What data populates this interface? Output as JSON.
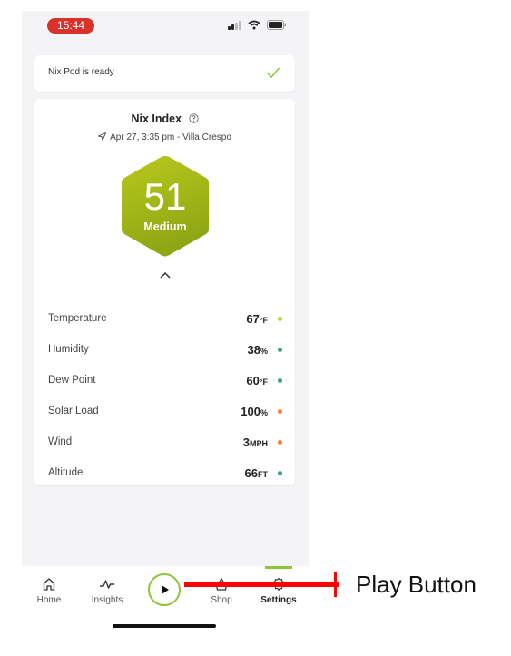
{
  "status_bar": {
    "time": "15:44"
  },
  "notice": {
    "text": "Nix Pod is ready"
  },
  "nix_index": {
    "title": "Nix Index",
    "location": "Apr 27, 3:35 pm - Villa Crespo",
    "value": "51",
    "level": "Medium"
  },
  "metrics": [
    {
      "label": "Temperature",
      "value": "67",
      "unit": "°F",
      "dot_color": "#b6d43a"
    },
    {
      "label": "Humidity",
      "value": "38",
      "unit": "%",
      "dot_color": "#3aa37a"
    },
    {
      "label": "Dew Point",
      "value": "60",
      "unit": "°F",
      "dot_color": "#3aa37a"
    },
    {
      "label": "Solar Load",
      "value": "100",
      "unit": "%",
      "dot_color": "#f07c3a"
    },
    {
      "label": "Wind",
      "value": "3",
      "unit": "MPH",
      "dot_color": "#f07c3a"
    },
    {
      "label": "Altitude",
      "value": "66",
      "unit": "FT",
      "dot_color": "#3aa37a"
    }
  ],
  "nav": {
    "home": "Home",
    "insights": "Insights",
    "shop": "Shop",
    "settings": "Settings"
  },
  "annotation": {
    "label": "Play Button"
  },
  "colors": {
    "accent": "#8ec33a",
    "annotation": "#ff0000",
    "time_pill": "#d9322b"
  },
  "icons": [
    "check-icon",
    "help-icon",
    "location-arrow-icon",
    "chevron-up-icon",
    "home-icon",
    "insights-icon",
    "play-icon",
    "shop-icon",
    "gear-icon"
  ]
}
